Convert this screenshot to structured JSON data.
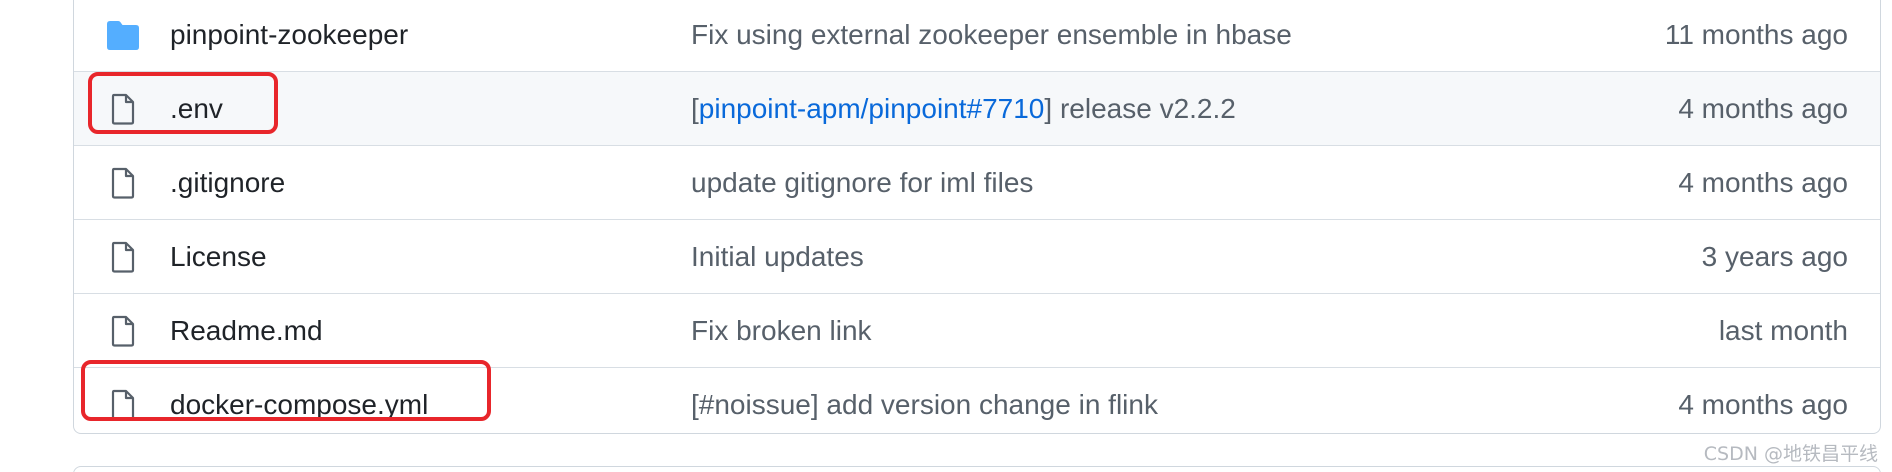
{
  "rows": [
    {
      "type": "folder",
      "icon": "folder-icon",
      "name": "pinpoint-zookeeper",
      "message": "Fix using external zookeeper ensemble in hbase",
      "age": "11 months ago"
    },
    {
      "type": "file",
      "icon": "file-icon",
      "name": ".env",
      "message_prefix": "[",
      "message_link": "pinpoint-apm/pinpoint#7710",
      "message_suffix": "] release v2.2.2",
      "age": "4 months ago"
    },
    {
      "type": "file",
      "icon": "file-icon",
      "name": ".gitignore",
      "message": "update gitignore for iml files",
      "age": "4 months ago"
    },
    {
      "type": "file",
      "icon": "file-icon",
      "name": "License",
      "message": "Initial updates",
      "age": "3 years ago"
    },
    {
      "type": "file",
      "icon": "file-icon",
      "name": "Readme.md",
      "message": "Fix broken link",
      "age": "last month"
    },
    {
      "type": "file",
      "icon": "file-icon",
      "name": "docker-compose.yml",
      "message": "[#noissue] add version change in flink",
      "age": "4 months ago"
    }
  ],
  "annotation_color": "#e8262b",
  "colors": {
    "folder": "#54aeff",
    "file_icon": "#57606a",
    "link": "#0969da",
    "text": "#1f2328",
    "muted": "#57606a"
  },
  "watermark": "CSDN @地铁昌平线"
}
